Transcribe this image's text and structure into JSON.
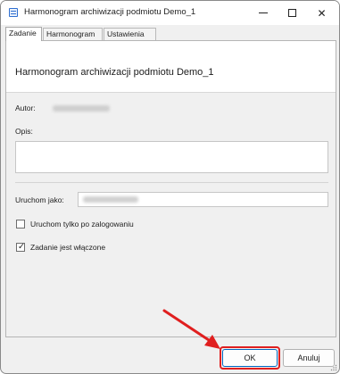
{
  "window": {
    "title": "Harmonogram archiwizacji podmiotu Demo_1",
    "app_icon": "schedule-app-icon"
  },
  "tabs": [
    {
      "label": "Zadanie",
      "active": true
    },
    {
      "label": "Harmonogram",
      "active": false
    },
    {
      "label": "Ustawienia",
      "active": false
    }
  ],
  "task": {
    "heading": "Harmonogram archiwizacji podmiotu Demo_1",
    "author_label": "Autor:",
    "author_value": "",
    "description_label": "Opis:",
    "description_value": "",
    "run_as_label": "Uruchom jako:",
    "run_as_value": "",
    "only_logged_on_label": "Uruchom tylko po zalogowaniu",
    "only_logged_on_checked": false,
    "enabled_label": "Zadanie jest włączone",
    "enabled_checked": true,
    "check_glyph": "✓"
  },
  "buttons": {
    "ok_label": "OK",
    "cancel_label": "Anuluj"
  },
  "annotation": {
    "highlight_color": "#e01f1f"
  },
  "window_controls": {
    "close_glyph": "✕"
  }
}
